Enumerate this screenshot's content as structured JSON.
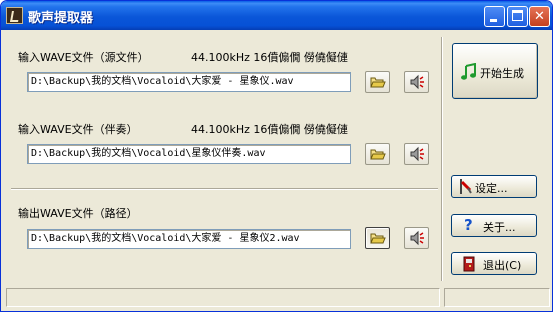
{
  "app": {
    "title": "歌声提取器"
  },
  "source": {
    "label": "输入WAVE文件（源文件）",
    "info": "44.100kHz 16僨傓僩 僗僥儗僆",
    "path": "D:\\Backup\\我的文档\\Vocaloid\\大家爱 - 星象仪.wav"
  },
  "accompaniment": {
    "label": "输入WAVE文件（伴奏）",
    "info": "44.100kHz 16僨傓僩 僗僥儗僆",
    "path": "D:\\Backup\\我的文档\\Vocaloid\\星象仪伴奏.wav"
  },
  "output": {
    "label": "输出WAVE文件（路径）",
    "path": "D:\\Backup\\我的文档\\Vocaloid\\大家爱 - 星象仪2.wav"
  },
  "actions": {
    "start_label": "开始生成",
    "settings_label": "设定...",
    "about_label": "关于...",
    "exit_label": "退出(C)"
  },
  "colors": {
    "titlebar": "#0a56d8",
    "window_bg": "#ece9d8",
    "accent_red": "#cc0000",
    "accent_green": "#1f9a2e",
    "accent_blue": "#1653c9"
  },
  "icons": [
    "program-icon",
    "minimize-icon",
    "maximize-icon",
    "close-icon",
    "folder-icon",
    "speaker-icon",
    "music-note-icon",
    "settings-icon",
    "help-icon",
    "exit-icon"
  ]
}
